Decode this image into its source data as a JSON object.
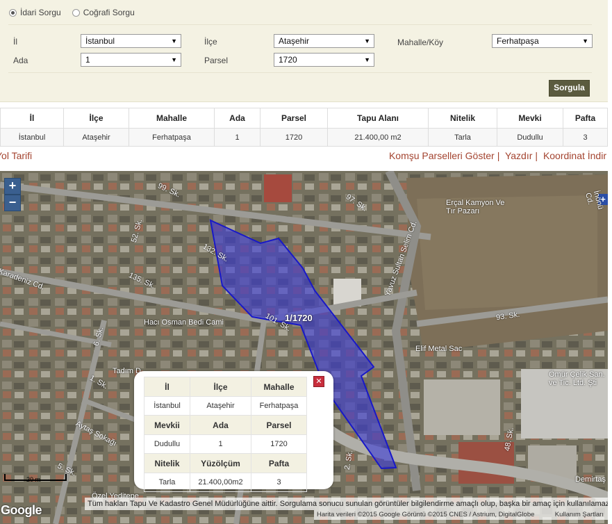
{
  "query": {
    "radio_options": [
      {
        "label": "İdari Sorgu",
        "selected": true
      },
      {
        "label": "Coğrafi Sorgu",
        "selected": false
      }
    ],
    "il_label": "İl",
    "il_value": "İstanbul",
    "ilce_label": "İlçe",
    "ilce_value": "Ataşehir",
    "mahalle_label": "Mahalle/Köy",
    "mahalle_value": "Ferhatpaşa",
    "ada_label": "Ada",
    "ada_value": "1",
    "parsel_label": "Parsel",
    "parsel_value": "1720",
    "submit_label": "Sorgula"
  },
  "results": {
    "headers": [
      "İl",
      "İlçe",
      "Mahalle",
      "Ada",
      "Parsel",
      "Tapu Alanı",
      "Nitelik",
      "Mevki",
      "Pafta"
    ],
    "row": [
      "İstanbul",
      "Ataşehir",
      "Ferhatpaşa",
      "1",
      "1720",
      "21.400,00 m2",
      "Tarla",
      "Dudullu",
      "3"
    ]
  },
  "links": {
    "route": "Yol Tarifi",
    "neighbors": "Komşu Parselleri Göster",
    "print": "Yazdır",
    "coords": "Koordinat İndir",
    "separator": "|"
  },
  "map": {
    "zoom_in": "+",
    "zoom_out": "−",
    "parcel_label": "1/1720",
    "street_labels": [
      "99. Sk.",
      "52. Sk.",
      "132. Sk.",
      "135. Sk.",
      "101. Sk.",
      "97. Sk.",
      "93. Sk.",
      "48. Sk.",
      "6. Sk.",
      "1. Sk.",
      "5. Sk.",
      "2. Sk.",
      "Aytaş Sokağı",
      "Yavuz Sultan Selim Cd.",
      "İnönü Cd.",
      "Karadeniz Cd."
    ],
    "poi_labels": [
      "Erçal Kamyon Ve Tır Pazarı",
      "Hacı Osman Bedi Cami",
      "Elif Metal Sac",
      "Ömür Çelik San. ve Tic. Ltd. Şti",
      "Tadım D",
      "Demirtaş",
      "Özel Yeditepe"
    ],
    "attribution": "Tüm hakları Tapu Ve Kadastro Genel Müdürlüğüne aittir. Sorgulama sonucu sunulan görüntüler bilgilendirme amaçlı olup, başka bir amaç için kullanılamaz.",
    "map_data": "Harita verileri ©2015 Google Görüntü ©2015 CNES / Astrium, DigitalGlobe",
    "terms": "Kullanım Şartları",
    "scale": "20 m",
    "google": "Google",
    "edge_plus": "+"
  },
  "popup": {
    "close": "✕",
    "rows": [
      {
        "type": "header",
        "cells": [
          "İl",
          "İlçe",
          "Mahalle"
        ]
      },
      {
        "type": "data",
        "cells": [
          "İstanbul",
          "Ataşehir",
          "Ferhatpaşa"
        ]
      },
      {
        "type": "header",
        "cells": [
          "Mevkii",
          "Ada",
          "Parsel"
        ]
      },
      {
        "type": "data",
        "cells": [
          "Dudullu",
          "1",
          "1720"
        ]
      },
      {
        "type": "header",
        "cells": [
          "Nitelik",
          "Yüzölçüm",
          "Pafta"
        ]
      },
      {
        "type": "data",
        "cells": [
          "Tarla",
          "21.400,00m2",
          "3"
        ]
      }
    ]
  },
  "colors": {
    "panel_bg": "#f4f2e3",
    "button_bg": "#5b5b3f",
    "link": "#a3432f",
    "parcel_fill": "#3a3ad8",
    "zoom_bg": "#3a5f8f"
  }
}
